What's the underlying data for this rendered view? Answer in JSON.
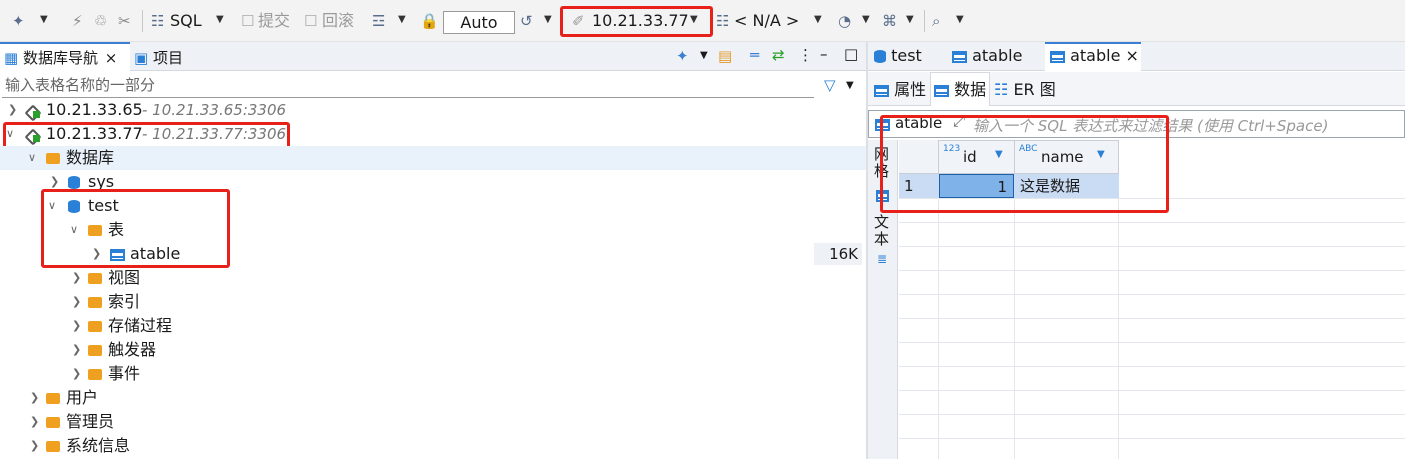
{
  "toolbar": {
    "sql_label": "SQL",
    "commit_label": "提交",
    "rollback_label": "回滚",
    "tx_mode": "Auto",
    "connection": "10.21.33.77",
    "schema": "< N/A >"
  },
  "left_panel": {
    "tabs": [
      {
        "label": "数据库导航",
        "close": "×"
      },
      {
        "label": "项目"
      }
    ],
    "filter_placeholder": "输入表格名称的一部分",
    "tree": {
      "conn1_label": "10.21.33.65",
      "conn1_detail": "- 10.21.33.65:3306",
      "conn2_label": "10.21.33.77",
      "conn2_detail": "- 10.21.33.77:3306",
      "databases": "数据库",
      "sys": "sys",
      "test": "test",
      "tables": "表",
      "atable": "atable",
      "atable_size": "16K",
      "views": "视图",
      "indexes": "索引",
      "procedures": "存储过程",
      "triggers": "触发器",
      "events": "事件",
      "users": "用户",
      "admins": "管理员",
      "sysinfo": "系统信息"
    }
  },
  "right_panel": {
    "editor_tabs": [
      {
        "label": "test"
      },
      {
        "label": "atable"
      },
      {
        "label": "atable",
        "close": "×"
      }
    ],
    "sub_tabs": [
      {
        "label": "属性"
      },
      {
        "label": "数据"
      },
      {
        "label": "ER 图"
      }
    ],
    "filter_table": "atable",
    "filter_placeholder": "输入一个 SQL 表达式来过滤结果 (使用 Ctrl+Space)",
    "side_tabs": {
      "grid": "网格",
      "text": "文本"
    },
    "grid": {
      "columns": [
        {
          "type_badge": "123",
          "name": "id"
        },
        {
          "type_badge": "ABC",
          "name": "name"
        }
      ],
      "rows": [
        {
          "num": "1",
          "id": "1",
          "name": "这是数据"
        }
      ]
    }
  },
  "colors": {
    "highlight_box": "#e8201a",
    "accent": "#3b7fd4",
    "selected_cell": "#7fb2e8"
  }
}
